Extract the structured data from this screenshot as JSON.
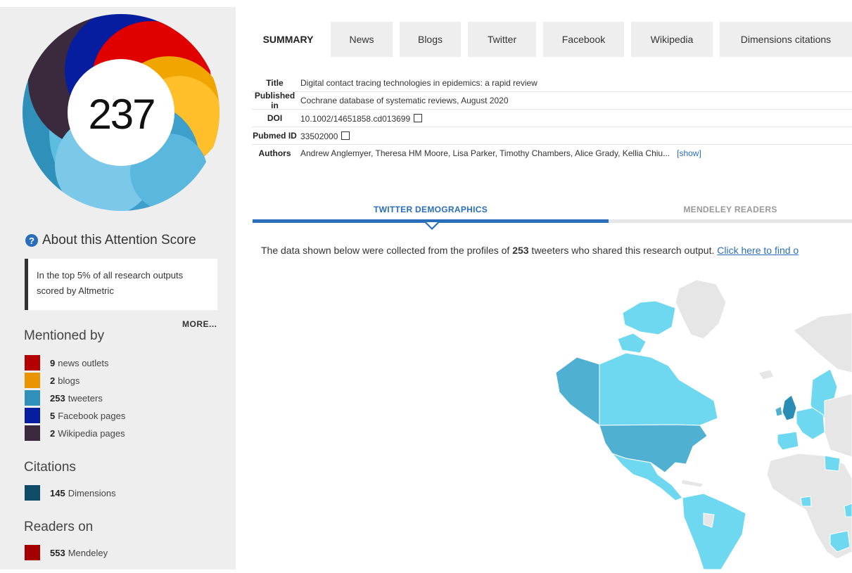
{
  "score": "237",
  "about": {
    "label": "About this Attention Score",
    "icon": "question-icon"
  },
  "top_box": {
    "text": "In the top 5% of all research outputs scored by Altmetric"
  },
  "more_label": "MORE...",
  "mentioned_by": {
    "heading": "Mentioned by",
    "items": [
      {
        "count": "9",
        "label": "news outlets",
        "color": "#b30000"
      },
      {
        "count": "2",
        "label": "blogs",
        "color": "#e89500"
      },
      {
        "count": "253",
        "label": "tweeters",
        "color": "#2f90b9"
      },
      {
        "count": "5",
        "label": "Facebook pages",
        "color": "#071d9f"
      },
      {
        "count": "2",
        "label": "Wikipedia pages",
        "color": "#3b2a3d"
      }
    ]
  },
  "citations": {
    "heading": "Citations",
    "items": [
      {
        "count": "145",
        "label": "Dimensions",
        "color": "#0f4a66"
      }
    ]
  },
  "readers": {
    "heading": "Readers on",
    "items": [
      {
        "count": "553",
        "label": "Mendeley",
        "color": "#a50000"
      }
    ]
  },
  "tabs": [
    "SUMMARY",
    "News",
    "Blogs",
    "Twitter",
    "Facebook",
    "Wikipedia",
    "Dimensions citations"
  ],
  "meta": {
    "title_key": "Title",
    "title": "Digital contact tracing technologies in epidemics: a rapid review",
    "published_key": "Published in",
    "published": "Cochrane database of systematic reviews, August 2020",
    "doi_key": "DOI",
    "doi": "10.1002/14651858.cd013699",
    "pubmed_key": "Pubmed ID",
    "pubmed": "33502000",
    "authors_key": "Authors",
    "authors": "Andrew Anglemyer, Theresa HM Moore, Lisa Parker, Timothy Chambers, Alice Grady, Kellia Chiu...",
    "show": "[show]"
  },
  "demo_tabs": {
    "twitter": "TWITTER DEMOGRAPHICS",
    "mendeley": "MENDELEY READERS"
  },
  "description": {
    "prefix": "The data shown below were collected from the profiles of ",
    "count": "253",
    "suffix": " tweeters who shared this research output. ",
    "link": "Click here to find o"
  },
  "colors": {
    "accent": "#2a6ebb",
    "sidebar_bg": "#eeeeee",
    "map_dark": "#2a8db3",
    "map_mid": "#4fb0d2",
    "map_light": "#6ed8f0",
    "map_none": "#e6e6e6"
  }
}
